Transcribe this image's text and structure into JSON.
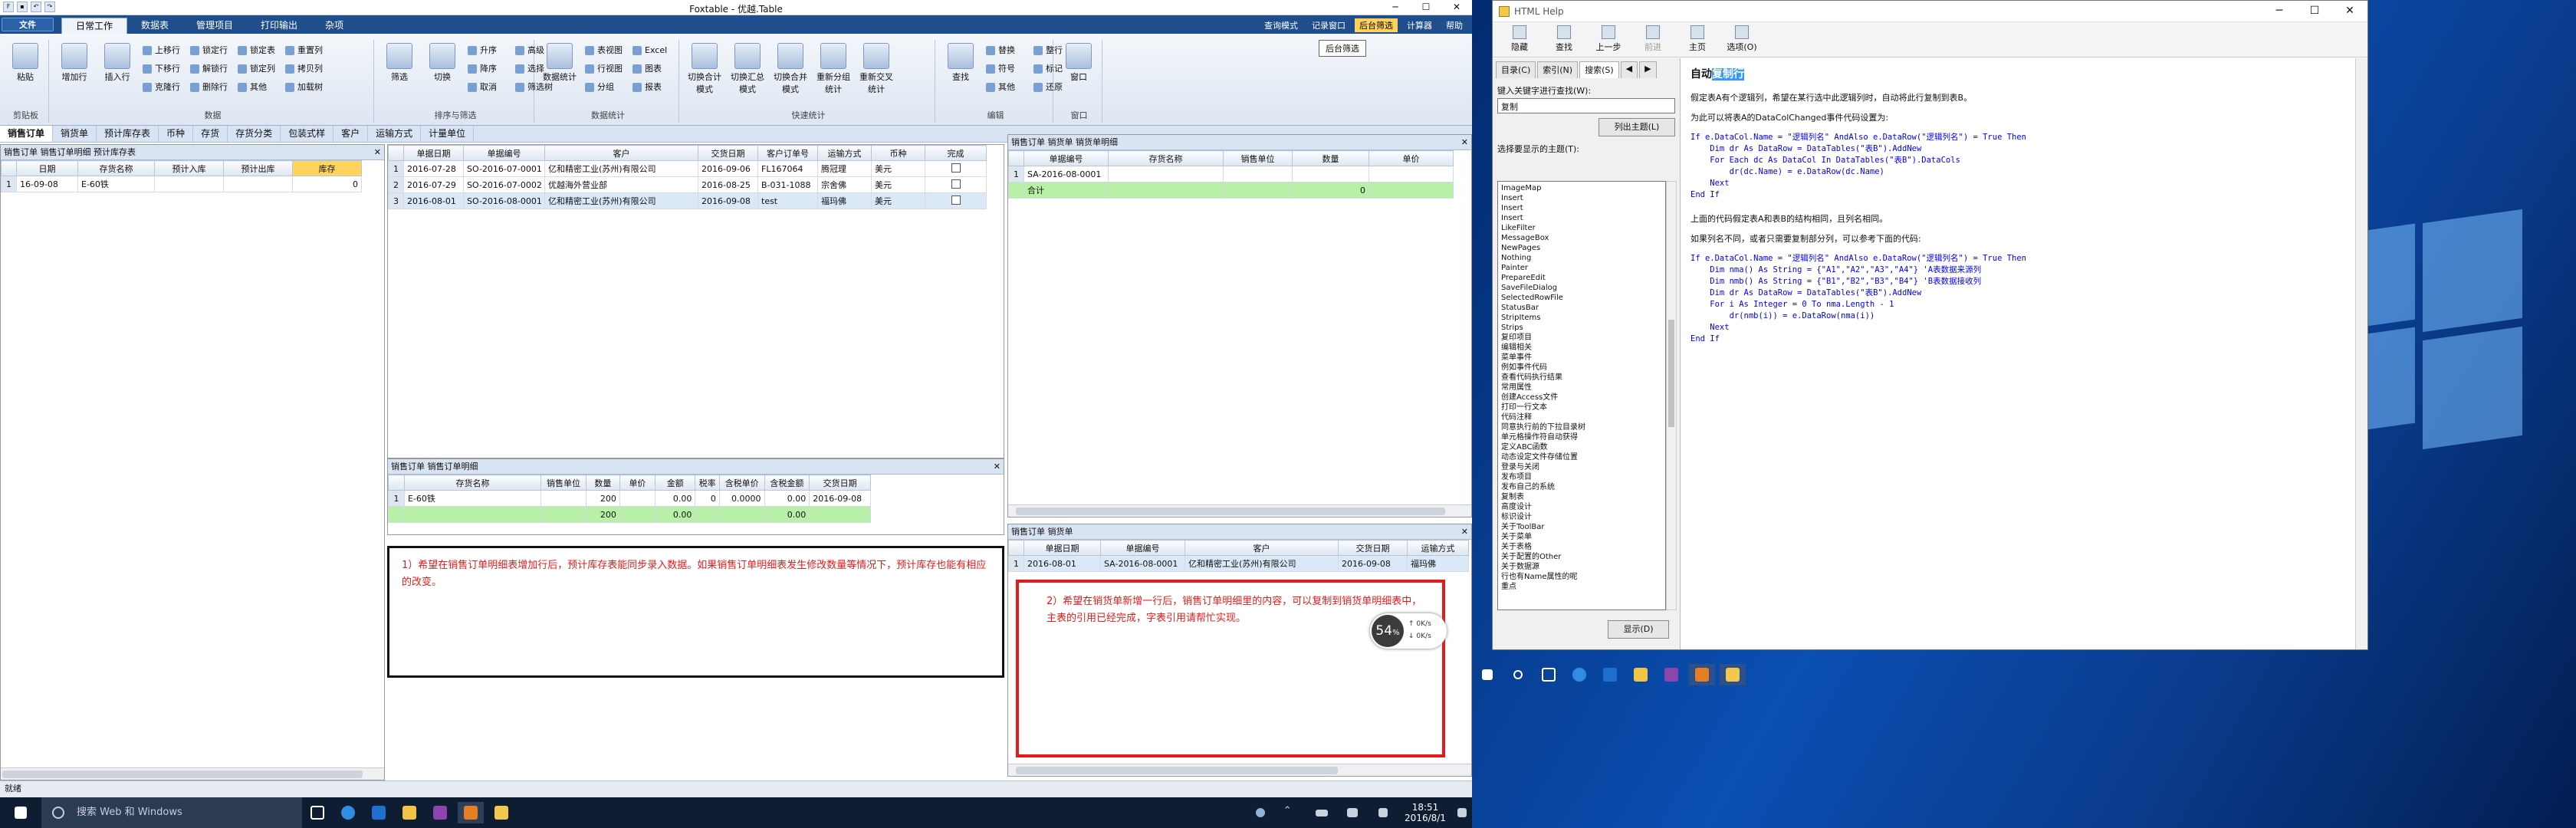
{
  "foxtable": {
    "title": "Foxtable - 优越.Table",
    "app_button": "文件",
    "menu_tabs": [
      "日常工作",
      "数据表",
      "管理项目",
      "打印输出",
      "杂项"
    ],
    "menu_right": [
      "查询模式",
      "记录窗口",
      "后台筛选",
      "计算器",
      "帮助"
    ],
    "ribbon": {
      "groups": [
        {
          "label": "剪贴板",
          "big": [
            "粘贴"
          ],
          "small": []
        },
        {
          "label": "数据",
          "big": [
            "增加行",
            "插入行"
          ],
          "small": [
            "上移行",
            "下移行",
            "克隆行",
            "锁定行",
            "解锁行",
            "删除行",
            "锁定表",
            "锁定列",
            "其他",
            "重置列",
            "拷贝列",
            "加载树"
          ]
        },
        {
          "label": "排序与筛选",
          "big": [
            "筛选",
            "切换"
          ],
          "small": [
            "升序",
            "降序",
            "取消",
            "高级",
            "选择",
            "筛选树"
          ]
        },
        {
          "label": "数据统计",
          "big": [
            "数据统计"
          ],
          "small": [
            "表视图",
            "行视图",
            "分组",
            "Excel",
            "图表",
            "报表"
          ]
        },
        {
          "label": "快速统计",
          "big": [
            "切换合计模式",
            "切换汇总模式",
            "切换合并模式",
            "重新分组统计",
            "重新交叉统计"
          ],
          "small": []
        },
        {
          "label": "编辑",
          "big": [
            "查找"
          ],
          "small": [
            "替换",
            "符号",
            "其他",
            "整行",
            "标记",
            "还原"
          ]
        },
        {
          "label": "窗口",
          "big": [
            "窗口"
          ],
          "small": []
        }
      ],
      "filter_hint": "后台筛选"
    },
    "sheet_tabs": [
      "销售订单",
      "销货单",
      "预计库存表",
      "币种",
      "存货",
      "存货分类",
      "包装式样",
      "客户",
      "运输方式",
      "计量单位"
    ],
    "panel_inventory": {
      "header": "销售订单  销售订单明细  预计库存表",
      "columns": [
        "日期",
        "存货名称",
        "预计入库",
        "预计出库",
        "库存"
      ],
      "rows": [
        [
          "16-09-08",
          "E-60铁",
          "",
          "",
          "0"
        ]
      ]
    },
    "panel_orders": {
      "columns": [
        "单据日期",
        "单据编号",
        "客户",
        "交货日期",
        "客户订单号",
        "运输方式",
        "币种",
        "完成"
      ],
      "rows": [
        [
          "2016-07-28",
          "SO-2016-07-0001",
          "亿和精密工业(苏州)有限公司",
          "2016-09-06",
          "FL167064",
          "腾冠理",
          "美元"
        ],
        [
          "2016-07-29",
          "SO-2016-07-0002",
          "优越海外营业部",
          "2016-08-25",
          "B-031-1088",
          "宗舍佛",
          "美元"
        ],
        [
          "2016-08-01",
          "SO-2016-08-0001",
          "亿和精密工业(苏州)有限公司",
          "2016-09-08",
          "test",
          "福玛佛",
          "美元"
        ]
      ]
    },
    "panel_order_detail": {
      "header": "销售订单  销售订单明细",
      "columns": [
        "存货名称",
        "销售单位",
        "数量",
        "单价",
        "金额",
        "税率",
        "含税单价",
        "含税金额",
        "交货日期"
      ],
      "rows": [
        [
          "E-60铁",
          "",
          "200",
          "",
          "0.00",
          "0",
          "0.0000",
          "0.00",
          "2016-09-08"
        ]
      ],
      "sum_row": [
        "",
        "",
        "200",
        "",
        "0.00",
        "",
        "",
        "0.00",
        ""
      ]
    },
    "panel_delivery_detail": {
      "header": "销售订单  销货单  销货单明细",
      "columns": [
        "单据编号",
        "存货名称",
        "销售单位",
        "数量",
        "单价"
      ],
      "rows": [
        [
          "SA-2016-08-0001",
          "",
          "",
          "",
          ""
        ]
      ],
      "sum_row": [
        "合计",
        "",
        "",
        "0",
        ""
      ]
    },
    "panel_delivery": {
      "header": "销售订单  销货单",
      "columns": [
        "单据日期",
        "单据编号",
        "客户",
        "交货日期",
        "运输方式"
      ],
      "rows": [
        [
          "2016-08-01",
          "SA-2016-08-0001",
          "亿和精密工业(苏州)有限公司",
          "2016-09-08",
          "福玛佛"
        ]
      ]
    },
    "note1": "1）希望在销售订单明细表增加行后，预计库存表能同步录入数据。如果销售订单明细表发生修改数量等情况下，预计库存也能有相应的改变。",
    "note2": "2）希望在销货单新增一行后，销售订单明细里的内容，可以复制到销货单明细表中，主表的引用已经完成，字表引用请帮忙实现。",
    "status": "就绪",
    "speed_widget": {
      "percent": "54",
      "unit": "%",
      "up": "0K/s",
      "down": "0K/s"
    }
  },
  "help": {
    "title": "HTML Help",
    "toolbar": [
      "隐藏",
      "查找",
      "上一步",
      "前进",
      "主页",
      "选项(O)"
    ],
    "tabs": [
      "目录(C)",
      "索引(N)",
      "搜索(S)"
    ],
    "keyword_label": "键入关键字进行查找(W):",
    "keyword_value": "复制",
    "list_button": "列出主题(L)",
    "topic_label": "选择要显示的主题(T):",
    "topics": [
      "ImageMap",
      "Insert",
      "Insert",
      "Insert",
      "LikeFilter",
      "MessageBox",
      "NewPages",
      "Nothing",
      "Painter",
      "PrepareEdit",
      "SaveFileDialog",
      "SelectedRowFile",
      "StatusBar",
      "StripItems",
      "Strips",
      "复印项目",
      "编辑相关",
      "菜单事件",
      "例如事件代码",
      "查看代码执行结果",
      "常用属性",
      "创建Access文件",
      "打印一行文本",
      "代码注释",
      "同意执行前的下拉目录树",
      "单元格操作符自动获得",
      "定义ABC函数",
      "动态设定文件存储位置",
      "登录与关闭",
      "发布项目",
      "发布自己的系统",
      "复制表",
      "高度设计",
      "标识设计",
      "关于ToolBar",
      "关于菜单",
      "关于表格",
      "关于配置的Other",
      "关于数据源",
      "行也有Name属性的呢",
      "重点"
    ],
    "show_button": "显示(D)",
    "content": {
      "heading_prefix": "自动",
      "heading_sel": "复制行",
      "p1": "假定表A有个逻辑列，希望在某行选中此逻辑列时，自动将此行复制到表B。",
      "p2": "为此可以将表A的DataColChanged事件代码设置为:",
      "code1": [
        "If e.DataCol.Name = \"逻辑列名\" AndAlso e.DataRow(\"逻辑列名\") = True Then",
        "    Dim dr As DataRow = DataTables(\"表B\").AddNew",
        "    For Each dc As DataCol In DataTables(\"表B\").DataCols",
        "        dr(dc.Name) = e.DataRow(dc.Name)",
        "    Next",
        "End If"
      ],
      "p3": "上面的代码假定表A和表B的结构相同，且列名相同。",
      "p4": "如果列名不同，或者只需要复制部分列，可以参考下面的代码:",
      "code2": [
        "If e.DataCol.Name = \"逻辑列名\" AndAlso e.DataRow(\"逻辑列名\") = True Then",
        "    Dim nma() As String = {\"A1\",\"A2\",\"A3\",\"A4\"} 'A表数据来源列",
        "    Dim nmb() As String = {\"B1\",\"B2\",\"B3\",\"B4\"} 'B表数据接收列",
        "    Dim dr As DataRow = DataTables(\"表B\").AddNew",
        "    For i As Integer = 0 To nma.Length - 1",
        "        dr(nmb(i)) = e.DataRow(nma(i))",
        "    Next",
        "End If"
      ]
    }
  },
  "taskbar": {
    "search_placeholder": "搜索 Web 和 Windows",
    "time": "18:51",
    "date": "2016/8/1"
  }
}
